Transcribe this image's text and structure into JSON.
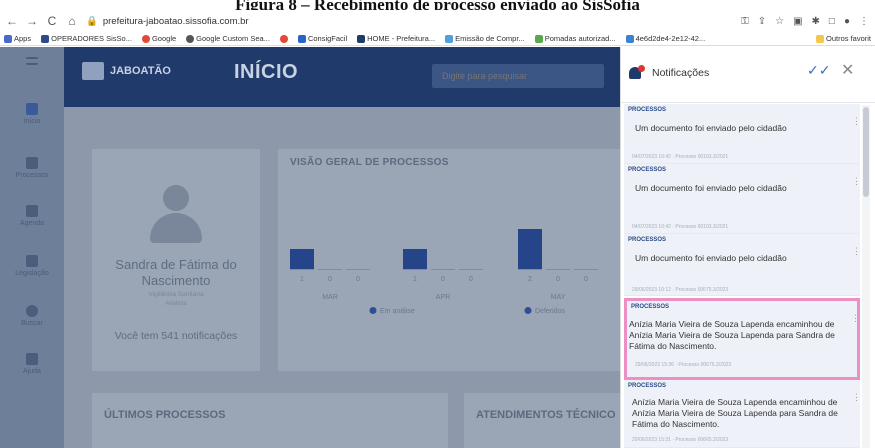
{
  "caption": "Figura 8 – Recebimento de processo enviado ao SisSofia",
  "browser": {
    "url": "prefeitura-jaboatao.sissofia.com.br"
  },
  "bookmarks": {
    "items": [
      "Apps",
      "OPERADORES SisSo...",
      "Google",
      "Google Custom Sea...",
      "ConsigFacil",
      "HOME - Prefeitura...",
      "Emissão de Compr...",
      "Pomadas autorizad...",
      "4e6d2de4-2e12-42..."
    ],
    "right": "Outros favorit"
  },
  "topbar": {
    "logo": "JABOATÃO",
    "title": "INÍCIO",
    "search_placeholder": "Digite para pesquisar"
  },
  "sidebar": {
    "items": [
      {
        "label": "Início"
      },
      {
        "label": "Processos"
      },
      {
        "label": "Agenda"
      },
      {
        "label": "Legislação"
      },
      {
        "label": "Buscar"
      },
      {
        "label": "Ajuda"
      }
    ]
  },
  "profile": {
    "name": "Sandra de Fátima do Nascimento",
    "role": "Vigilância Sanitária",
    "sub": "Analista",
    "notifications": "Você tem 541 notificações"
  },
  "overview": {
    "title": "VISÃO GERAL DE PROCESSOS"
  },
  "bottom": {
    "left_title": "ÚLTIMOS PROCESSOS",
    "right_title": "ATENDIMENTOS TÉCNICO"
  },
  "notifications": {
    "title": "Notificações",
    "items": [
      {
        "category": "PROCESSOS",
        "text": "Um documento foi enviado pelo cidadão",
        "meta": "04/07/2023 10:42 · Processo 00103.3/2021"
      },
      {
        "category": "PROCESSOS",
        "text": "Um documento foi enviado pelo cidadão",
        "meta": "04/07/2023 10:42 · Processo 00103.3/2021"
      },
      {
        "category": "PROCESSOS",
        "text": "Um documento foi enviado pelo cidadão",
        "meta": "29/06/2023 10:12 · Processo 00675.3/2023"
      },
      {
        "category": "PROCESSOS",
        "text": "Anízia Maria Vieira de Souza Lapenda encaminhou de Anízia Maria Vieira de Souza Lapenda para Sandra de Fátima do Nascimento.",
        "meta": "29/06/2023 15:36 · Processo 00675.3/2023"
      },
      {
        "category": "PROCESSOS",
        "text": "Anízia Maria Vieira de Souza Lapenda encaminhou de Anízia Maria Vieira de Souza Lapenda para Sandra de Fátima do Nascimento.",
        "meta": "29/06/2023 15:31 · Processo 00665.3/2023"
      }
    ]
  },
  "chart_data": {
    "type": "bar",
    "categories": [
      "MAR",
      "APR",
      "MAY"
    ],
    "series": [
      {
        "name": "Em análise",
        "values": [
          1,
          1,
          2
        ]
      },
      {
        "name": "",
        "values": [
          0,
          0,
          0
        ]
      },
      {
        "name": "Deferidos",
        "values": [
          0,
          0,
          0
        ]
      }
    ],
    "value_labels": [
      [
        "1",
        "0",
        "0"
      ],
      [
        "1",
        "0",
        "0"
      ],
      [
        "2",
        "0",
        "0"
      ]
    ],
    "legend": [
      "Em análise",
      "Deferidos"
    ],
    "colors": {
      "bar": "#26448a",
      "legend_dot": "#2e4f96"
    },
    "ylim": [
      0,
      2
    ]
  }
}
